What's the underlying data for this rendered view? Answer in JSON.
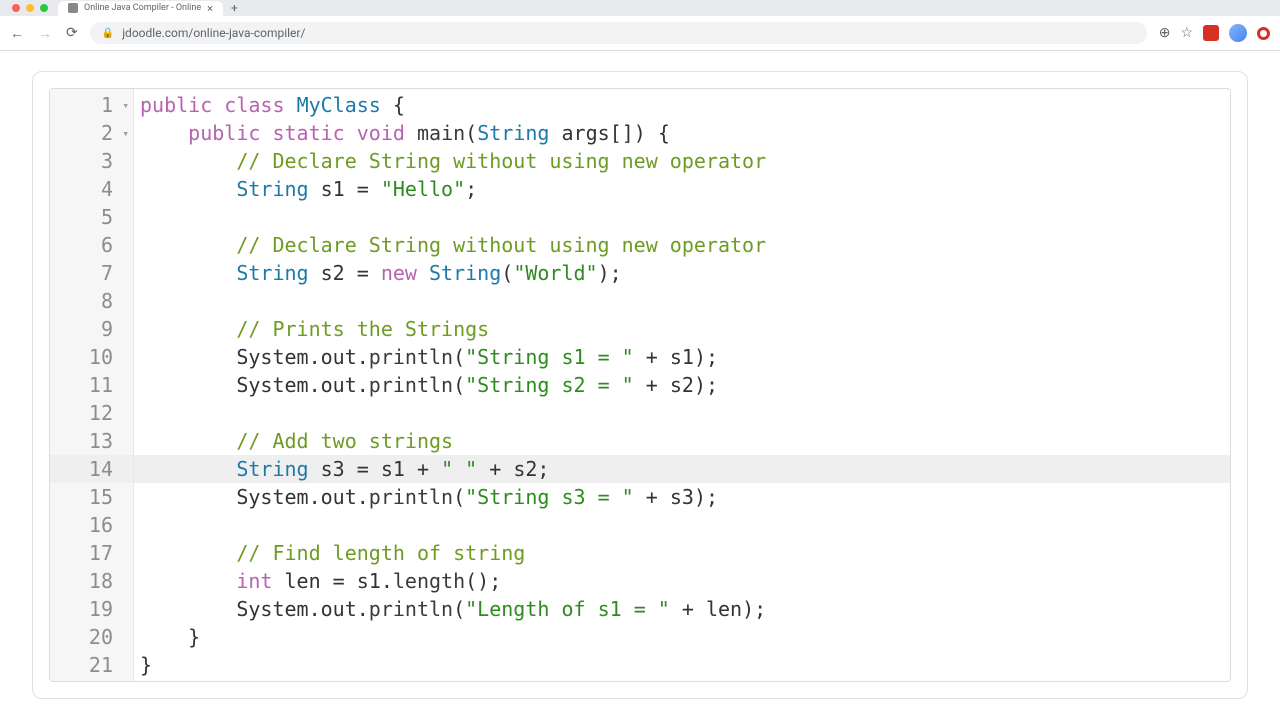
{
  "browser": {
    "tab_title": "Online Java Compiler - Online",
    "url": "jdoodle.com/online-java-compiler/"
  },
  "editor": {
    "highlighted_line": 14,
    "fold_lines": [
      1,
      2
    ],
    "lines": [
      {
        "n": 1,
        "tokens": [
          [
            "kw",
            "public"
          ],
          [
            "pn",
            " "
          ],
          [
            "kw",
            "class"
          ],
          [
            "pn",
            " "
          ],
          [
            "tp",
            "MyClass"
          ],
          [
            "pn",
            " {"
          ]
        ]
      },
      {
        "n": 2,
        "tokens": [
          [
            "pn",
            "    "
          ],
          [
            "kw",
            "public"
          ],
          [
            "pn",
            " "
          ],
          [
            "kw",
            "static"
          ],
          [
            "pn",
            " "
          ],
          [
            "kw",
            "void"
          ],
          [
            "pn",
            " "
          ],
          [
            "fn",
            "main"
          ],
          [
            "pn",
            "("
          ],
          [
            "tp",
            "String"
          ],
          [
            "pn",
            " "
          ],
          [
            "id",
            "args"
          ],
          [
            "pn",
            "[]) {"
          ]
        ]
      },
      {
        "n": 3,
        "tokens": [
          [
            "pn",
            "        "
          ],
          [
            "cmt",
            "// Declare String without using new operator"
          ]
        ]
      },
      {
        "n": 4,
        "tokens": [
          [
            "pn",
            "        "
          ],
          [
            "tp",
            "String"
          ],
          [
            "pn",
            " "
          ],
          [
            "id",
            "s1"
          ],
          [
            "pn",
            " = "
          ],
          [
            "str",
            "\"Hello\""
          ],
          [
            "pn",
            ";"
          ]
        ]
      },
      {
        "n": 5,
        "tokens": []
      },
      {
        "n": 6,
        "tokens": [
          [
            "pn",
            "        "
          ],
          [
            "cmt",
            "// Declare String without using new operator"
          ]
        ]
      },
      {
        "n": 7,
        "tokens": [
          [
            "pn",
            "        "
          ],
          [
            "tp",
            "String"
          ],
          [
            "pn",
            " "
          ],
          [
            "id",
            "s2"
          ],
          [
            "pn",
            " = "
          ],
          [
            "kw",
            "new"
          ],
          [
            "pn",
            " "
          ],
          [
            "tp",
            "String"
          ],
          [
            "pn",
            "("
          ],
          [
            "str",
            "\"World\""
          ],
          [
            "pn",
            ");"
          ]
        ]
      },
      {
        "n": 8,
        "tokens": []
      },
      {
        "n": 9,
        "tokens": [
          [
            "pn",
            "        "
          ],
          [
            "cmt",
            "// Prints the Strings"
          ]
        ]
      },
      {
        "n": 10,
        "tokens": [
          [
            "pn",
            "        "
          ],
          [
            "id",
            "System"
          ],
          [
            "pn",
            "."
          ],
          [
            "id",
            "out"
          ],
          [
            "pn",
            "."
          ],
          [
            "fn",
            "println"
          ],
          [
            "pn",
            "("
          ],
          [
            "str",
            "\"String s1 = \""
          ],
          [
            "pn",
            " + "
          ],
          [
            "id",
            "s1"
          ],
          [
            "pn",
            ");"
          ]
        ]
      },
      {
        "n": 11,
        "tokens": [
          [
            "pn",
            "        "
          ],
          [
            "id",
            "System"
          ],
          [
            "pn",
            "."
          ],
          [
            "id",
            "out"
          ],
          [
            "pn",
            "."
          ],
          [
            "fn",
            "println"
          ],
          [
            "pn",
            "("
          ],
          [
            "str",
            "\"String s2 = \""
          ],
          [
            "pn",
            " + "
          ],
          [
            "id",
            "s2"
          ],
          [
            "pn",
            ");"
          ]
        ]
      },
      {
        "n": 12,
        "tokens": []
      },
      {
        "n": 13,
        "tokens": [
          [
            "pn",
            "        "
          ],
          [
            "cmt",
            "// Add two strings"
          ]
        ]
      },
      {
        "n": 14,
        "tokens": [
          [
            "pn",
            "        "
          ],
          [
            "tp",
            "String"
          ],
          [
            "pn",
            " "
          ],
          [
            "id",
            "s3"
          ],
          [
            "pn",
            " = "
          ],
          [
            "id",
            "s1"
          ],
          [
            "pn",
            " + "
          ],
          [
            "str",
            "\" \""
          ],
          [
            "pn",
            " + "
          ],
          [
            "id",
            "s2"
          ],
          [
            "pn",
            ";"
          ]
        ]
      },
      {
        "n": 15,
        "tokens": [
          [
            "pn",
            "        "
          ],
          [
            "id",
            "System"
          ],
          [
            "pn",
            "."
          ],
          [
            "id",
            "out"
          ],
          [
            "pn",
            "."
          ],
          [
            "fn",
            "println"
          ],
          [
            "pn",
            "("
          ],
          [
            "str",
            "\"String s3 = \""
          ],
          [
            "pn",
            " + "
          ],
          [
            "id",
            "s3"
          ],
          [
            "pn",
            ");"
          ]
        ]
      },
      {
        "n": 16,
        "tokens": []
      },
      {
        "n": 17,
        "tokens": [
          [
            "pn",
            "        "
          ],
          [
            "cmt",
            "// Find length of string"
          ]
        ]
      },
      {
        "n": 18,
        "tokens": [
          [
            "pn",
            "        "
          ],
          [
            "kw",
            "int"
          ],
          [
            "pn",
            " "
          ],
          [
            "id",
            "len"
          ],
          [
            "pn",
            " = "
          ],
          [
            "id",
            "s1"
          ],
          [
            "pn",
            "."
          ],
          [
            "fn",
            "length"
          ],
          [
            "pn",
            "();"
          ]
        ]
      },
      {
        "n": 19,
        "tokens": [
          [
            "pn",
            "        "
          ],
          [
            "id",
            "System"
          ],
          [
            "pn",
            "."
          ],
          [
            "id",
            "out"
          ],
          [
            "pn",
            "."
          ],
          [
            "fn",
            "println"
          ],
          [
            "pn",
            "("
          ],
          [
            "str",
            "\"Length of s1 = \""
          ],
          [
            "pn",
            " + "
          ],
          [
            "id",
            "len"
          ],
          [
            "pn",
            ");"
          ]
        ]
      },
      {
        "n": 20,
        "tokens": [
          [
            "pn",
            "    }"
          ]
        ]
      },
      {
        "n": 21,
        "tokens": [
          [
            "pn",
            "}"
          ]
        ]
      }
    ]
  }
}
